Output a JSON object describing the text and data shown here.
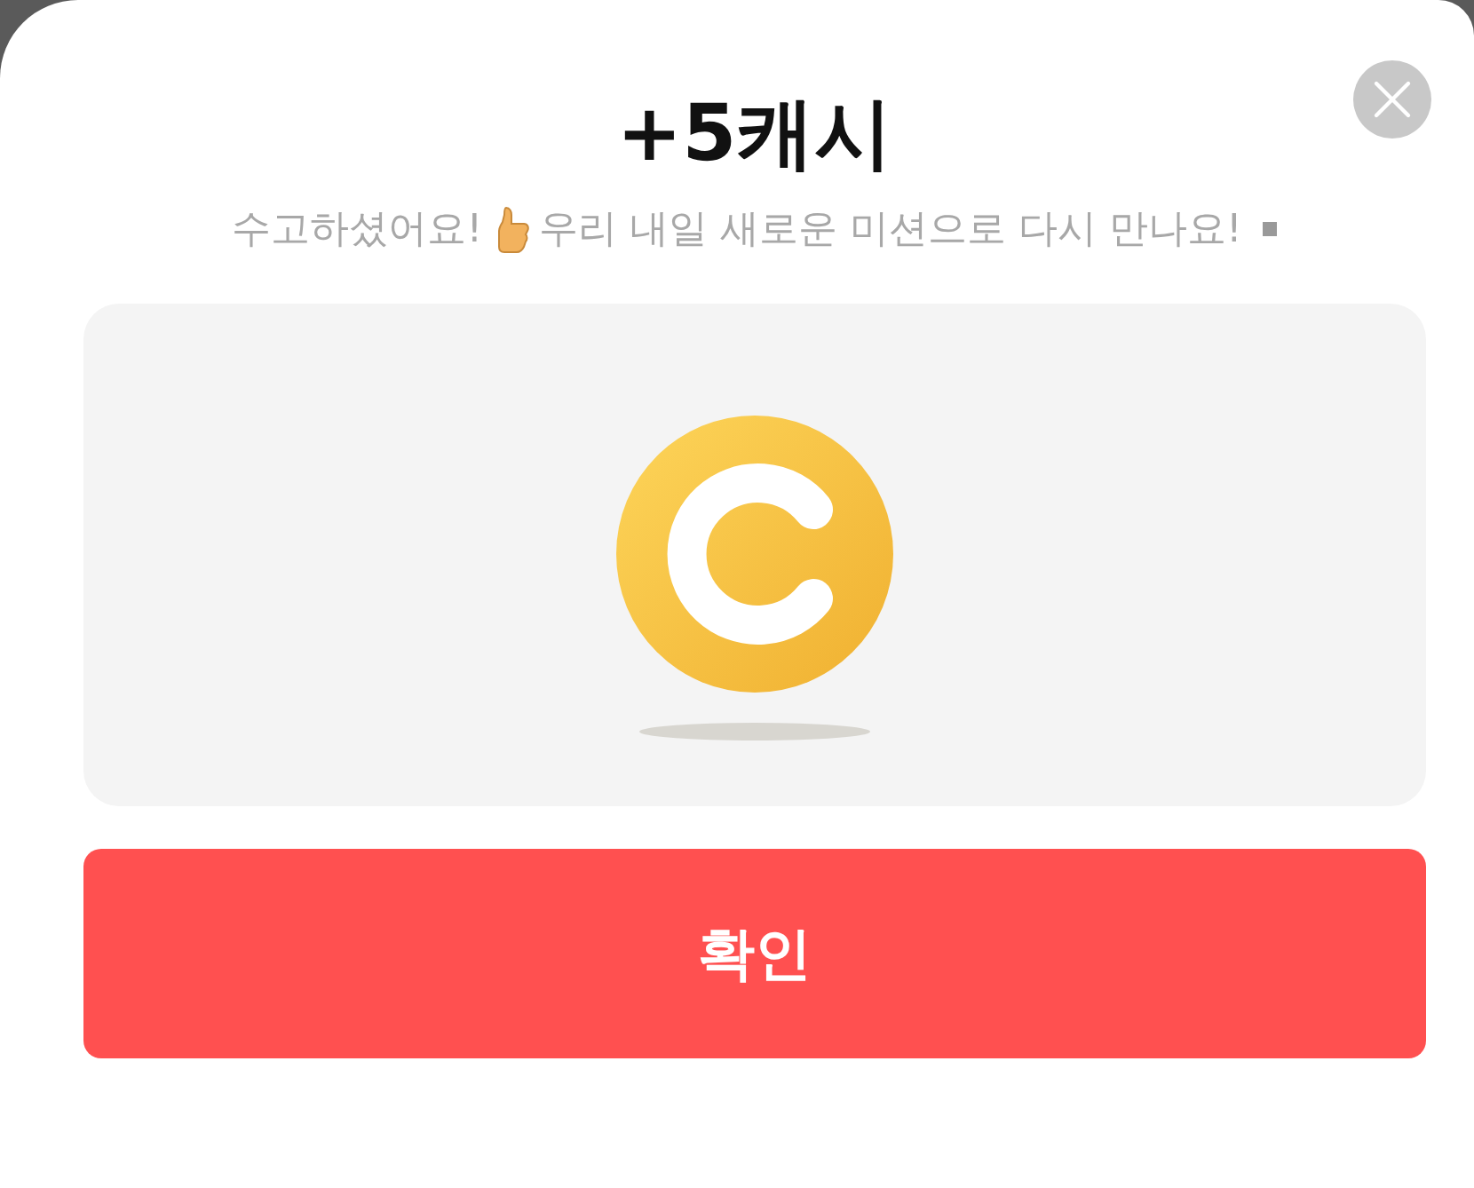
{
  "dialog": {
    "title": "+5캐시",
    "message_start": "수고하셨어요!",
    "message_end": "우리 내일 새로운 미션으로 다시 만나요!",
    "confirm_button": "확인"
  }
}
